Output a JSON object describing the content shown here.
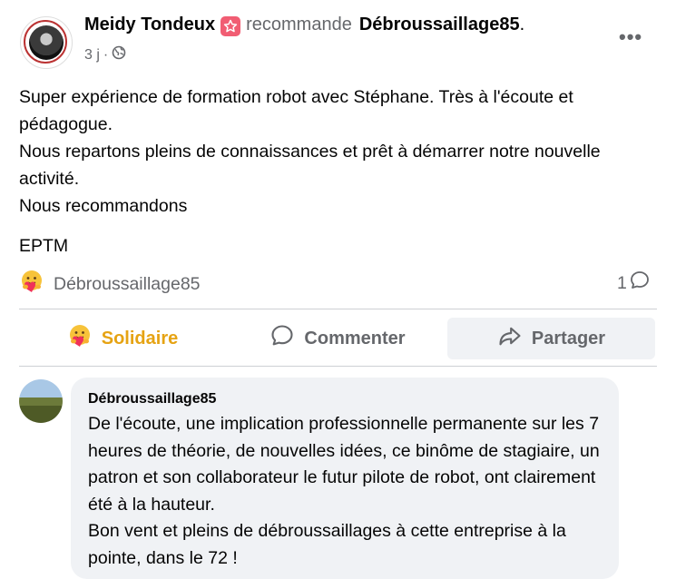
{
  "post": {
    "author": "Meidy Tondeux",
    "action": "recommande",
    "page": "Débroussaillage85",
    "period": ".",
    "time": "3 j",
    "separator": "·",
    "more_label": "•••",
    "paragraphs": [
      "Super expérience de formation robot avec Stéphane. Très à l'écoute et pédagogue.",
      "Nous repartons pleins de connaissances et prêt à démarrer notre nouvelle activité.",
      "Nous recommandons",
      "EPTM"
    ]
  },
  "reactions": {
    "summary_name": "Débroussaillage85",
    "comment_count": "1"
  },
  "actions": {
    "like_label": "Solidaire",
    "comment_label": "Commenter",
    "share_label": "Partager"
  },
  "comment": {
    "author": "Débroussaillage85",
    "paragraphs": [
      "De l'écoute, une implication professionnelle permanente sur les 7 heures de théorie, de nouvelles idées, ce binôme de stagiaire, un patron et son collaborateur le futur pilote de robot, ont clairement été à la hauteur.",
      "Bon vent et pleins de débroussaillages à cette entreprise à la pointe, dans le 72 !"
    ]
  },
  "colors": {
    "accent_reaction": "#e6a313",
    "badge": "#f15d73",
    "secondary_text": "#65676b"
  },
  "icons": [
    "globe-icon",
    "star-badge-icon",
    "care-reaction-icon",
    "comment-icon",
    "share-icon",
    "more-icon"
  ]
}
